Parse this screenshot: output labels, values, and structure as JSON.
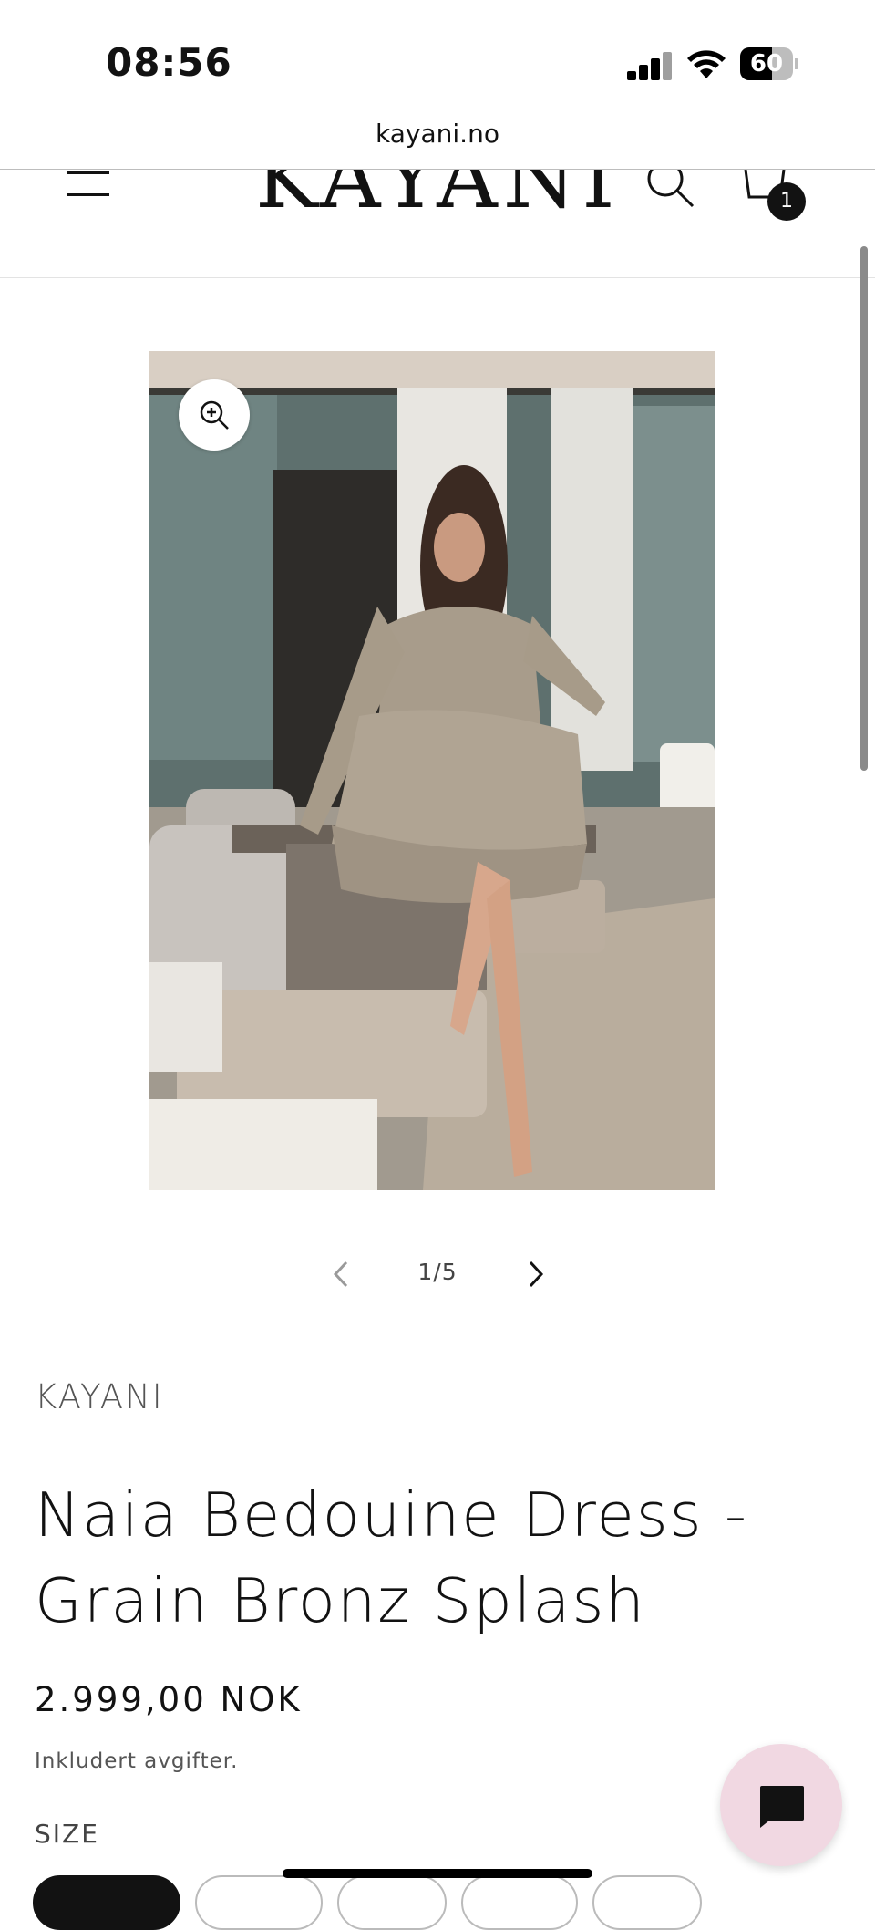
{
  "status_bar": {
    "time": "08:56",
    "battery": "60",
    "battery_level": 0.6
  },
  "browser": {
    "url": "kayani.no"
  },
  "header": {
    "logo": "KAYANI",
    "cart_count": "1"
  },
  "gallery": {
    "counter": "1/5",
    "current": 1,
    "total": 5
  },
  "product": {
    "vendor": "KAYANI",
    "title": "Naia Bedouine Dress - Grain Bronz Splash",
    "price": "2.999,00 NOK",
    "tax_note": "Inkludert avgifter.",
    "size_label": "SIZE"
  },
  "colors": {
    "accent": "#121212",
    "chat_button": "#f1d8e2"
  }
}
